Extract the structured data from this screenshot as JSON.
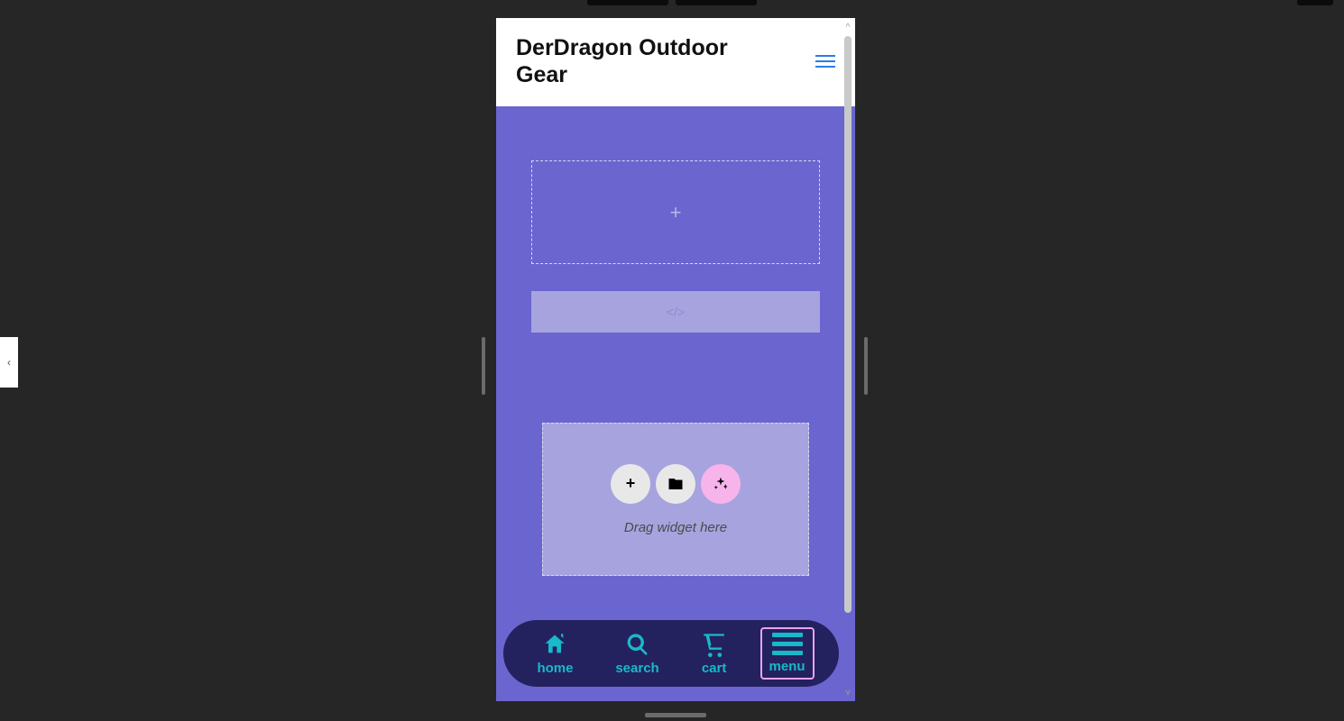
{
  "header": {
    "title": "DerDragon Outdoor Gear"
  },
  "hero": {
    "plus_glyph": "+",
    "skeleton_label": "</>",
    "drop_hint": "Drag widget here"
  },
  "nav": {
    "items": [
      {
        "label": "home"
      },
      {
        "label": "search"
      },
      {
        "label": "cart"
      },
      {
        "label": "menu"
      }
    ]
  },
  "side_tool": {
    "glyph": "‹"
  }
}
